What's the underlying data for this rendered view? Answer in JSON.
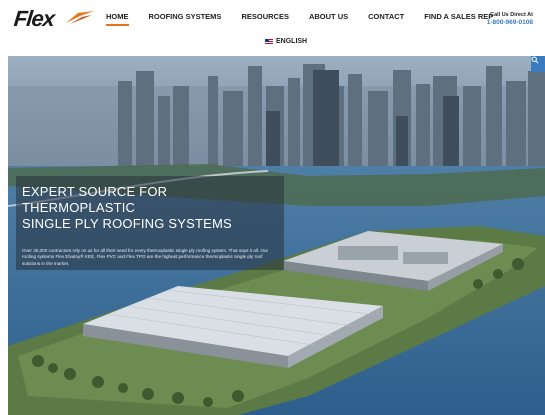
{
  "brand": {
    "logo_text": "Flex",
    "accent": "#e8731a"
  },
  "nav": {
    "items": [
      {
        "label": "HOME",
        "active": true
      },
      {
        "label": "ROOFING SYSTEMS",
        "active": false
      },
      {
        "label": "RESOURCES",
        "active": false
      },
      {
        "label": "ABOUT US",
        "active": false
      },
      {
        "label": "CONTACT",
        "active": false
      },
      {
        "label": "FIND A SALES REP",
        "active": false
      }
    ]
  },
  "contact": {
    "call_label": "Call Us Direct At",
    "phone": "1-800-969-0108",
    "phone_color": "#3a7bbf"
  },
  "language": {
    "label": "ENGLISH",
    "icon": "us-flag-icon"
  },
  "hero": {
    "search_icon": "search-icon",
    "headline_lines": [
      "EXPERT SOURCE FOR",
      "THERMOPLASTIC",
      "SINGLE PLY ROOFING SYSTEMS"
    ],
    "subtext": "Over 30,000 contractors rely on us for all their need for every thermoplastic single ply roofing system. That says it all. Our roofing systems Flex Elvaloy® KEE, Flex PVC and Flex TPO are the highest performance thermoplastic single ply roof solutions in the market."
  }
}
